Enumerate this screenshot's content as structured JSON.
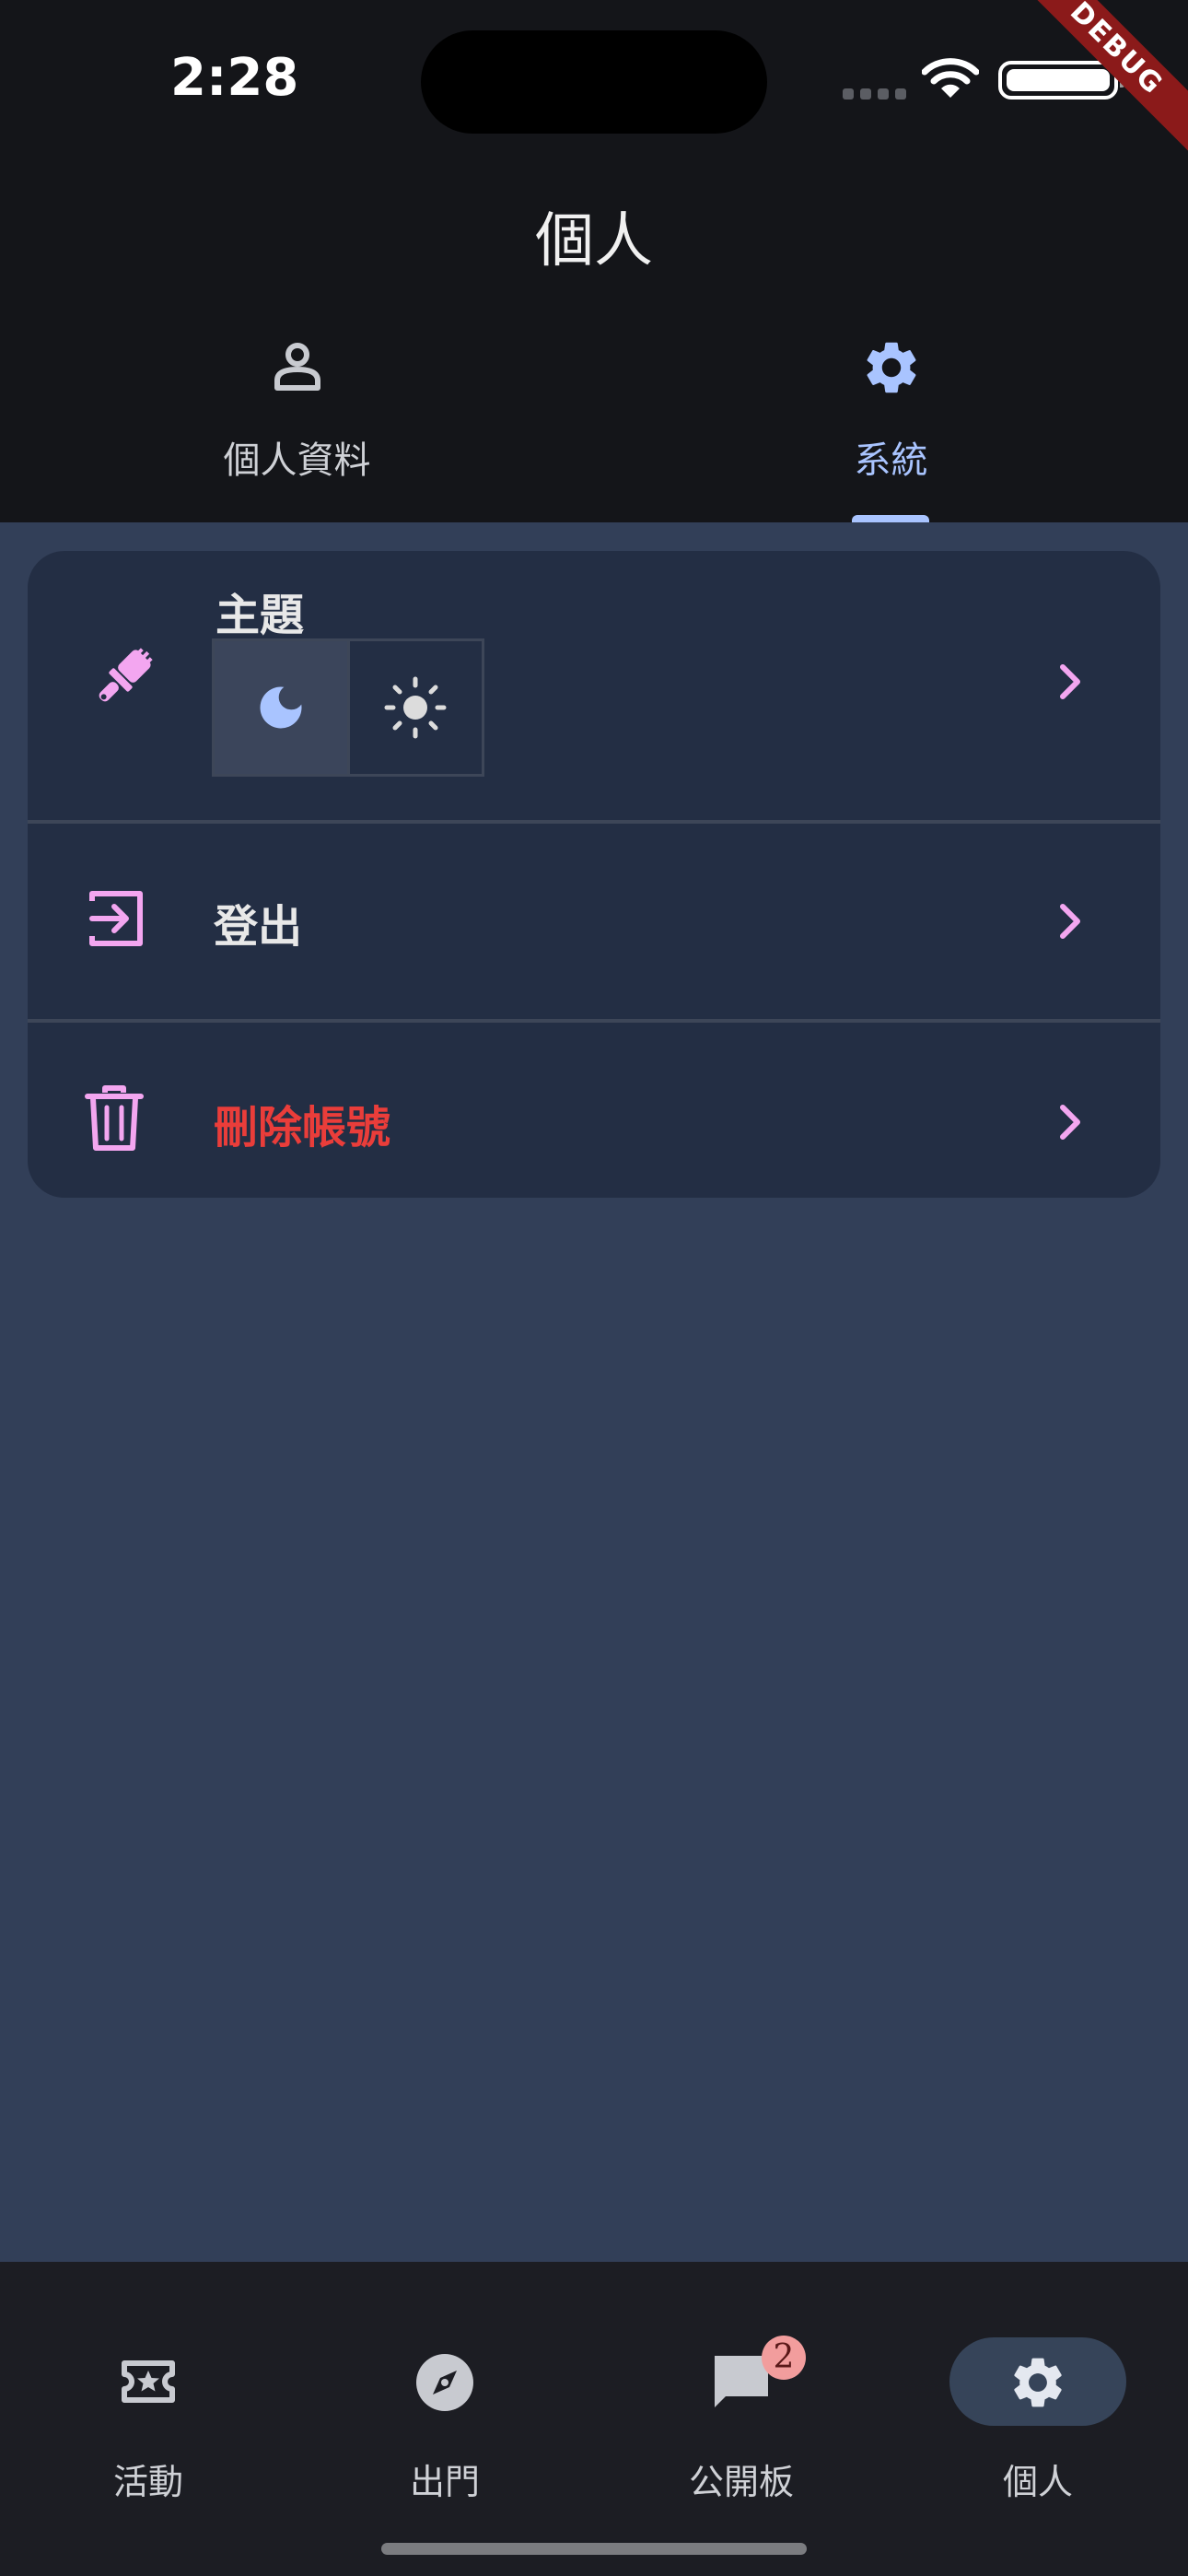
{
  "status_bar": {
    "time": "2:28",
    "debug_banner": "DEBUG"
  },
  "app_bar": {
    "title": "個人",
    "tabs": [
      {
        "label": "個人資料",
        "icon": "person-outline-icon",
        "selected": false
      },
      {
        "label": "系統",
        "icon": "gear-icon",
        "selected": true
      }
    ]
  },
  "settings": {
    "theme": {
      "label": "主題",
      "icon": "paintbrush-icon",
      "options": [
        "dark",
        "light"
      ],
      "selected": "dark"
    },
    "logout": {
      "label": "登出",
      "icon": "logout-icon"
    },
    "delete_account": {
      "label": "刪除帳號",
      "icon": "trash-icon"
    }
  },
  "bottom_nav": {
    "items": [
      {
        "label": "活動",
        "icon": "ticket-star-icon",
        "active": false
      },
      {
        "label": "出門",
        "icon": "compass-icon",
        "active": false
      },
      {
        "label": "公開板",
        "icon": "chat-icon",
        "active": false,
        "badge": "2"
      },
      {
        "label": "個人",
        "icon": "gear-icon",
        "active": true
      }
    ]
  },
  "colors": {
    "accent": "#a9c4ff",
    "pink": "#f3a6f0",
    "danger": "#ea3d3a",
    "background": "#323f58",
    "card": "#232e44"
  }
}
